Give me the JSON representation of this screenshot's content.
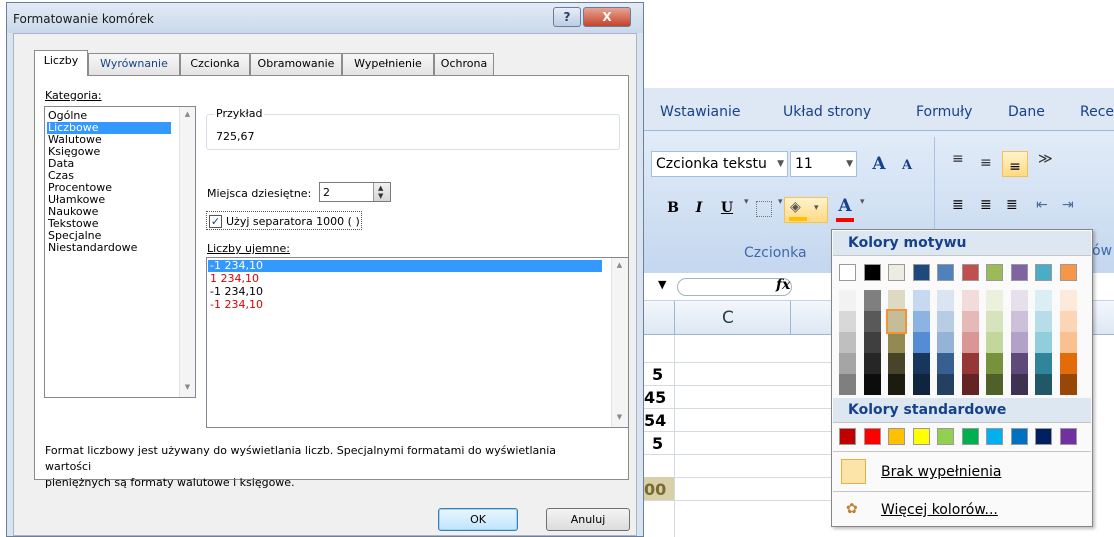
{
  "dialog": {
    "title": "Formatowanie komórek",
    "tabs": [
      "Liczby",
      "Wyrównanie",
      "Czcionka",
      "Obramowanie",
      "Wypełnienie",
      "Ochrona"
    ],
    "category_label": "Kategoria:",
    "categories": [
      "Ogólne",
      "Liczbowe",
      "Walutowe",
      "Księgowe",
      "Data",
      "Czas",
      "Procentowe",
      "Ułamkowe",
      "Naukowe",
      "Tekstowe",
      "Specjalne",
      "Niestandardowe"
    ],
    "selected_category": "Liczbowe",
    "example_label": "Przykład",
    "example_value": "725,67",
    "decimal_label": "Miejsca dziesiętne:",
    "decimal_value": "2",
    "separator_label": "Użyj separatora 1000 ( )",
    "separator_checked": true,
    "negative_label": "Liczby ujemne:",
    "negative_options": [
      {
        "text": "-1 234,10",
        "color": "#000000",
        "selected": true
      },
      {
        "text": "1 234,10",
        "color": "#e00000",
        "selected": false
      },
      {
        "text": "-1 234,10",
        "color": "#000000",
        "selected": false
      },
      {
        "text": "-1 234,10",
        "color": "#e00000",
        "selected": false
      }
    ],
    "description_line1": "Format liczbowy jest używany do wyświetlania liczb. Specjalnymi formatami do wyświetlania wartości",
    "description_line2": "pieniężnych są formaty walutowe i księgowe.",
    "ok_label": "OK",
    "cancel_label": "Anuluj",
    "help_glyph": "?",
    "close_glyph": "X"
  },
  "ribbon": {
    "tabs": [
      "Wstawianie",
      "Układ strony",
      "Formuły",
      "Dane",
      "Rece"
    ],
    "font_name": "Czcionka tekstu",
    "font_size": "11",
    "group_label": "Czcionka",
    "grow_glyph": "A",
    "shrink_glyph": "A",
    "bold": "B",
    "italic": "I",
    "underline": "U",
    "font_color_glyph": "A",
    "fill_color": "#ffc000",
    "font_color": "#ff0000",
    "cut_text": "ów"
  },
  "sheet": {
    "fx_label": "fx",
    "column_header": "C",
    "cell_values": [
      "5",
      "45",
      "54",
      "5",
      "00"
    ]
  },
  "color_menu": {
    "theme_header": "Kolory motywu",
    "theme_colors": [
      "#ffffff",
      "#000000",
      "#eeece1",
      "#1f497d",
      "#4f81bd",
      "#c0504d",
      "#9bbb59",
      "#8064a2",
      "#4bacc6",
      "#f79646"
    ],
    "theme_shades": [
      [
        "#f2f2f2",
        "#d8d8d8",
        "#bfbfbf",
        "#a5a5a5",
        "#7f7f7f"
      ],
      [
        "#7f7f7f",
        "#595959",
        "#3f3f3f",
        "#262626",
        "#0c0c0c"
      ],
      [
        "#ddd9c3",
        "#c4bd97",
        "#938953",
        "#494429",
        "#1d1b10"
      ],
      [
        "#c6d9f0",
        "#8db3e2",
        "#548dd4",
        "#17365d",
        "#0f243e"
      ],
      [
        "#dbe5f1",
        "#b8cce4",
        "#95b3d7",
        "#366092",
        "#244061"
      ],
      [
        "#f2dcdb",
        "#e5b9b7",
        "#d99694",
        "#953734",
        "#632423"
      ],
      [
        "#ebf1dd",
        "#d7e3bc",
        "#c3d69b",
        "#76923c",
        "#4f6128"
      ],
      [
        "#e5e0ec",
        "#ccc1d9",
        "#b2a2c7",
        "#5f497a",
        "#3f3151"
      ],
      [
        "#dbeef3",
        "#b7dde8",
        "#92cddc",
        "#31859b",
        "#205867"
      ],
      [
        "#fdeada",
        "#fbd5b5",
        "#fac08f",
        "#e36c09",
        "#974806"
      ]
    ],
    "standard_header": "Kolory standardowe",
    "standard_colors": [
      "#c00000",
      "#ff0000",
      "#ffc000",
      "#ffff00",
      "#92d050",
      "#00b050",
      "#00b0f0",
      "#0070c0",
      "#002060",
      "#7030a0"
    ],
    "no_fill_label": "Brak wypełnienia",
    "more_colors_label": "Więcej kolorów..."
  }
}
